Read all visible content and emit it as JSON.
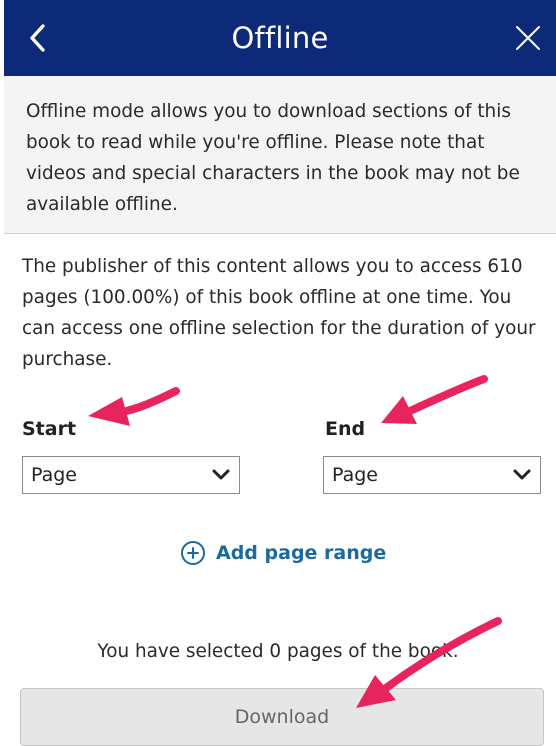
{
  "header": {
    "title": "Offline",
    "back_icon": "chevron-left-icon",
    "close_icon": "close-icon",
    "color": "#0d2a78"
  },
  "info": {
    "text": "Offline mode allows you to download sections of this book to read while you're offline. Please note that videos and special characters in the book may not be available offline."
  },
  "publisher_note": {
    "text": "The publisher of this content allows you to access 610 pages (100.00%) of this book offline at one time. You can access one offline selection for the duration of your purchase."
  },
  "start": {
    "label": "Start",
    "selected": "Page"
  },
  "end": {
    "label": "End",
    "selected": "Page"
  },
  "add_range": {
    "label": "Add page range",
    "icon": "plus-circle-icon"
  },
  "selection_status": "You have selected 0 pages of the book.",
  "download_button": {
    "label": "Download"
  },
  "annotation_color": "#e8245e"
}
